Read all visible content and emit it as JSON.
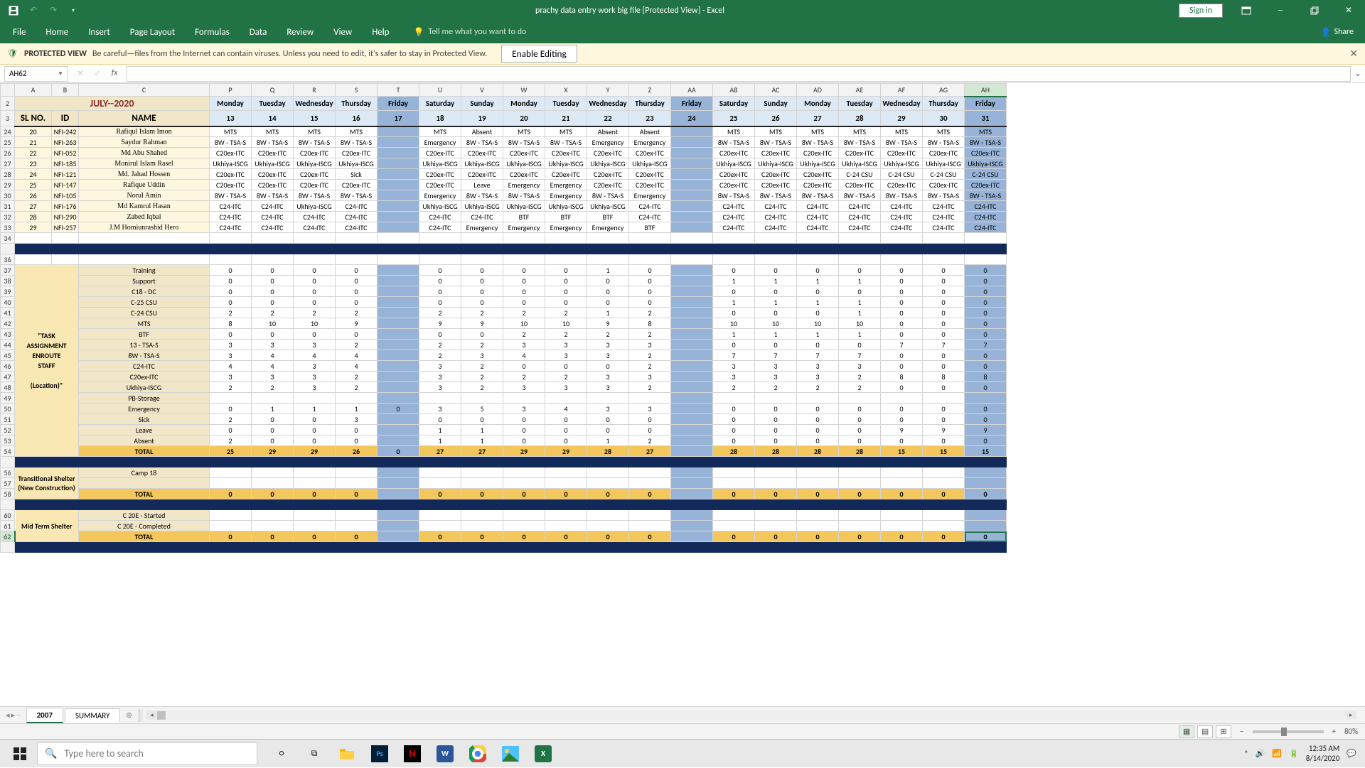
{
  "window": {
    "title": "prachy data entry work big file  [Protected View]  -  Excel",
    "signin": "Sign in"
  },
  "ribbon": {
    "tabs": [
      "File",
      "Home",
      "Insert",
      "Page Layout",
      "Formulas",
      "Data",
      "Review",
      "View",
      "Help"
    ],
    "tellme": "Tell me what you want to do",
    "share": "Share"
  },
  "protected": {
    "label": "PROTECTED VIEW",
    "text": "Be careful—files from the Internet can contain viruses. Unless you need to edit, it's safer to stay in Protected View.",
    "enable": "Enable Editing"
  },
  "namebox": "AH62",
  "cols": [
    "A",
    "B",
    "C",
    "P",
    "Q",
    "R",
    "S",
    "T",
    "U",
    "V",
    "W",
    "X",
    "Y",
    "Z",
    "AA",
    "AB",
    "AC",
    "AD",
    "AE",
    "AF",
    "AG",
    "AH"
  ],
  "month": "JULY--2020",
  "weekdays": [
    "Monday",
    "Tuesday",
    "Wednesday",
    "Thursday",
    "Friday",
    "Saturday",
    "Sunday",
    "Monday",
    "Tuesday",
    "Wednesday",
    "Thursday",
    "Friday",
    "Saturday",
    "Sunday",
    "Monday",
    "Tuesday",
    "Wednesday",
    "Thursday",
    "Friday"
  ],
  "daynums": [
    "13",
    "14",
    "15",
    "16",
    "17",
    "18",
    "19",
    "20",
    "21",
    "22",
    "23",
    "24",
    "25",
    "26",
    "27",
    "28",
    "29",
    "30",
    "31"
  ],
  "head": {
    "sl": "SL NO.",
    "id": "ID",
    "name": "NAME"
  },
  "rownums_staff": [
    "24",
    "25",
    "26",
    "27",
    "28",
    "29",
    "30",
    "31",
    "32",
    "33"
  ],
  "staff": [
    {
      "sl": "20",
      "id": "NFI-242",
      "name": "Rafiqul Islam Imon",
      "v": [
        "MTS",
        "MTS",
        "MTS",
        "MTS",
        "",
        "MTS",
        "Absent",
        "MTS",
        "MTS",
        "Absent",
        "Absent",
        "",
        "MTS",
        "MTS",
        "MTS",
        "MTS",
        "MTS",
        "MTS",
        "MTS"
      ]
    },
    {
      "sl": "21",
      "id": "NFI-263",
      "name": "Saydur Rahman",
      "v": [
        "8W - TSA-S",
        "8W - TSA-S",
        "8W - TSA-S",
        "8W - TSA-S",
        "",
        "Emergency",
        "8W - TSA-S",
        "8W - TSA-S",
        "8W - TSA-S",
        "Emergency",
        "Emergency",
        "",
        "8W - TSA-S",
        "8W - TSA-S",
        "8W - TSA-S",
        "8W - TSA-S",
        "8W - TSA-S",
        "8W - TSA-S",
        "8W - TSA-S"
      ]
    },
    {
      "sl": "22",
      "id": "NFI-052",
      "name": "Md Abu Shahed",
      "v": [
        "C20ex-ITC",
        "C20ex-ITC",
        "C20ex-ITC",
        "C20ex-ITC",
        "",
        "C20ex-ITC",
        "C20ex-ITC",
        "C20ex-ITC",
        "C20ex-ITC",
        "C20ex-ITC",
        "C20ex-ITC",
        "",
        "C20ex-ITC",
        "C20ex-ITC",
        "C20ex-ITC",
        "C20ex-ITC",
        "C20ex-ITC",
        "C20ex-ITC",
        "C20ex-ITC"
      ]
    },
    {
      "sl": "23",
      "id": "NFI-185",
      "name": "Monirul Islam Rasel",
      "v": [
        "Ukhiya-ISCG",
        "Ukhiya-ISCG",
        "Ukhiya-ISCG",
        "Ukhiya-ISCG",
        "",
        "Ukhiya-ISCG",
        "Ukhiya-ISCG",
        "Ukhiya-ISCG",
        "Ukhiya-ISCG",
        "Ukhiya-ISCG",
        "Ukhiya-ISCG",
        "",
        "Ukhiya-ISCG",
        "Ukhiya-ISCG",
        "Ukhiya-ISCG",
        "Ukhiya-ISCG",
        "Ukhiya-ISCG",
        "Ukhiya-ISCG",
        "Ukhiya-ISCG"
      ]
    },
    {
      "sl": "24",
      "id": "NFI-121",
      "name": "Md. Jahad Hossen",
      "v": [
        "C20ex-ITC",
        "C20ex-ITC",
        "C20ex-ITC",
        "Sick",
        "",
        "C20ex-ITC",
        "C20ex-ITC",
        "C20ex-ITC",
        "C20ex-ITC",
        "C20ex-ITC",
        "C20ex-ITC",
        "",
        "C20ex-ITC",
        "C20ex-ITC",
        "C20ex-ITC",
        "C-24 CSU",
        "C-24 CSU",
        "C-24 CSU",
        "C-24 CSU"
      ]
    },
    {
      "sl": "25",
      "id": "NFI-147",
      "name": "Rafique Uddin",
      "v": [
        "C20ex-ITC",
        "C20ex-ITC",
        "C20ex-ITC",
        "C20ex-ITC",
        "",
        "C20ex-ITC",
        "Leave",
        "Emergency",
        "Emergency",
        "C20ex-ITC",
        "C20ex-ITC",
        "",
        "C20ex-ITC",
        "C20ex-ITC",
        "C20ex-ITC",
        "C20ex-ITC",
        "C20ex-ITC",
        "C20ex-ITC",
        "C20ex-ITC"
      ]
    },
    {
      "sl": "26",
      "id": "NFI-105",
      "name": "Norul Amin",
      "v": [
        "8W - TSA-S",
        "8W - TSA-S",
        "8W - TSA-S",
        "8W - TSA-S",
        "",
        "Emergency",
        "8W - TSA-S",
        "8W - TSA-S",
        "Emergency",
        "8W - TSA-S",
        "Emergency",
        "",
        "8W - TSA-S",
        "8W - TSA-S",
        "8W - TSA-S",
        "8W - TSA-S",
        "8W - TSA-S",
        "8W - TSA-S",
        "8W - TSA-S"
      ]
    },
    {
      "sl": "27",
      "id": "NFI-176",
      "name": "Md Kamrul Hasan",
      "v": [
        "C24-ITC",
        "C24-ITC",
        "Ukhiya-ISCG",
        "C24-ITC",
        "",
        "Ukhiya-ISCG",
        "Ukhiya-ISCG",
        "Ukhiya-ISCG",
        "Ukhiya-ISCG",
        "Ukhiya-ISCG",
        "C24-ITC",
        "",
        "C24-ITC",
        "C24-ITC",
        "C24-ITC",
        "C24-ITC",
        "C24-ITC",
        "C24-ITC",
        "C24-ITC"
      ]
    },
    {
      "sl": "28",
      "id": "NFI-290",
      "name": "Zabed Iqbal",
      "v": [
        "C24-ITC",
        "C24-ITC",
        "C24-ITC",
        "C24-ITC",
        "",
        "C24-ITC",
        "C24-ITC",
        "BTF",
        "BTF",
        "BTF",
        "C24-ITC",
        "",
        "C24-ITC",
        "C24-ITC",
        "C24-ITC",
        "C24-ITC",
        "C24-ITC",
        "C24-ITC",
        "C24-ITC"
      ]
    },
    {
      "sl": "29",
      "id": "NFI-257",
      "name": "J.M Homiunrashid Hero",
      "v": [
        "C24-ITC",
        "C24-ITC",
        "C24-ITC",
        "C24-ITC",
        "",
        "C24-ITC",
        "Emergency",
        "Emergency",
        "Emergency",
        "Emergency",
        "BTF",
        "",
        "C24-ITC",
        "C24-ITC",
        "C24-ITC",
        "C24-ITC",
        "C24-ITC",
        "C24-ITC",
        "C24-ITC"
      ]
    }
  ],
  "task_label_lines": [
    "\"TASK",
    "ASSIGNMENT",
    "ENROUTE",
    "STAFF",
    "",
    "(Location)\""
  ],
  "rownums_task": [
    "37",
    "38",
    "39",
    "40",
    "41",
    "42",
    "43",
    "44",
    "45",
    "46",
    "47",
    "48",
    "49",
    "50",
    "51",
    "52",
    "53",
    "54"
  ],
  "tasks": [
    {
      "cat": "Training",
      "v": [
        "0",
        "0",
        "0",
        "0",
        "",
        "0",
        "0",
        "0",
        "0",
        "1",
        "0",
        "",
        "0",
        "0",
        "0",
        "0",
        "0",
        "0",
        "0"
      ]
    },
    {
      "cat": "Support",
      "v": [
        "0",
        "0",
        "0",
        "0",
        "",
        "0",
        "0",
        "0",
        "0",
        "0",
        "0",
        "",
        "1",
        "1",
        "1",
        "1",
        "0",
        "0",
        "0"
      ]
    },
    {
      "cat": "C18 - DC",
      "v": [
        "0",
        "0",
        "0",
        "0",
        "",
        "0",
        "0",
        "0",
        "0",
        "0",
        "0",
        "",
        "0",
        "0",
        "0",
        "0",
        "0",
        "0",
        "0"
      ]
    },
    {
      "cat": "C-25 CSU",
      "v": [
        "0",
        "0",
        "0",
        "0",
        "",
        "0",
        "0",
        "0",
        "0",
        "0",
        "0",
        "",
        "1",
        "1",
        "1",
        "1",
        "0",
        "0",
        "0"
      ]
    },
    {
      "cat": "C-24 CSU",
      "v": [
        "2",
        "2",
        "2",
        "2",
        "",
        "2",
        "2",
        "2",
        "2",
        "1",
        "2",
        "",
        "0",
        "0",
        "0",
        "1",
        "0",
        "0",
        "0"
      ]
    },
    {
      "cat": "MTS",
      "v": [
        "8",
        "10",
        "10",
        "9",
        "",
        "9",
        "9",
        "10",
        "10",
        "9",
        "8",
        "",
        "10",
        "10",
        "10",
        "10",
        "0",
        "0",
        "0"
      ]
    },
    {
      "cat": "BTF",
      "v": [
        "0",
        "0",
        "0",
        "0",
        "",
        "0",
        "0",
        "2",
        "2",
        "2",
        "2",
        "",
        "1",
        "1",
        "1",
        "1",
        "0",
        "0",
        "0"
      ]
    },
    {
      "cat": "13 - TSA-S",
      "v": [
        "3",
        "3",
        "3",
        "2",
        "",
        "2",
        "2",
        "3",
        "3",
        "3",
        "3",
        "",
        "0",
        "0",
        "0",
        "0",
        "7",
        "7",
        "7"
      ]
    },
    {
      "cat": "8W - TSA-S",
      "v": [
        "3",
        "4",
        "4",
        "4",
        "",
        "2",
        "3",
        "4",
        "3",
        "3",
        "2",
        "",
        "7",
        "7",
        "7",
        "7",
        "0",
        "0",
        "0"
      ]
    },
    {
      "cat": "C24-ITC",
      "v": [
        "4",
        "4",
        "3",
        "4",
        "",
        "3",
        "2",
        "0",
        "0",
        "0",
        "2",
        "",
        "3",
        "3",
        "3",
        "3",
        "0",
        "0",
        "0"
      ]
    },
    {
      "cat": "C20ex-ITC",
      "v": [
        "3",
        "3",
        "3",
        "2",
        "",
        "3",
        "2",
        "2",
        "2",
        "3",
        "3",
        "",
        "3",
        "3",
        "3",
        "2",
        "8",
        "8",
        "8"
      ]
    },
    {
      "cat": "Ukhiya-ISCG",
      "v": [
        "2",
        "2",
        "3",
        "2",
        "",
        "3",
        "2",
        "3",
        "3",
        "3",
        "2",
        "",
        "2",
        "2",
        "2",
        "2",
        "0",
        "0",
        "0"
      ]
    },
    {
      "cat": "PB-Storage",
      "v": [
        "",
        "",
        "",
        "",
        "",
        "",
        "",
        "",
        "",
        "",
        "",
        "",
        "",
        "",
        "",
        "",
        "",
        "",
        ""
      ]
    },
    {
      "cat": "Emergency",
      "v": [
        "0",
        "1",
        "1",
        "1",
        "0",
        "3",
        "5",
        "3",
        "4",
        "3",
        "3",
        "",
        "0",
        "0",
        "0",
        "0",
        "0",
        "0",
        "0"
      ]
    },
    {
      "cat": "Sick",
      "v": [
        "2",
        "0",
        "0",
        "3",
        "",
        "0",
        "0",
        "0",
        "0",
        "0",
        "0",
        "",
        "0",
        "0",
        "0",
        "0",
        "0",
        "0",
        "0"
      ]
    },
    {
      "cat": "Leave",
      "v": [
        "0",
        "0",
        "0",
        "0",
        "",
        "1",
        "1",
        "0",
        "0",
        "0",
        "0",
        "",
        "0",
        "0",
        "0",
        "0",
        "9",
        "9",
        "9"
      ]
    },
    {
      "cat": "Absent",
      "v": [
        "2",
        "0",
        "0",
        "0",
        "",
        "1",
        "1",
        "0",
        "0",
        "1",
        "2",
        "",
        "0",
        "0",
        "0",
        "0",
        "0",
        "0",
        "0"
      ]
    }
  ],
  "task_total": {
    "cat": "TOTAL",
    "v": [
      "25",
      "29",
      "29",
      "26",
      "0",
      "27",
      "27",
      "29",
      "29",
      "28",
      "27",
      "",
      "28",
      "28",
      "28",
      "28",
      "15",
      "15",
      "15"
    ]
  },
  "shelter_label_lines": [
    "Transitional Shelter",
    "(New Construction)"
  ],
  "rownums_shelter": [
    "56",
    "57",
    "58"
  ],
  "shelter": {
    "camp": "Camp 18",
    "total_lbl": "TOTAL",
    "v": [
      "0",
      "0",
      "0",
      "0",
      "",
      "0",
      "0",
      "0",
      "0",
      "0",
      "0",
      "",
      "0",
      "0",
      "0",
      "0",
      "0",
      "0",
      "0"
    ]
  },
  "mts_label": "Mid Term Shelter",
  "rownums_mts": [
    "60",
    "61",
    "62"
  ],
  "mts": {
    "rows": [
      {
        "cat": "C 20E - Started",
        "v": [
          "",
          "",
          "",
          "",
          "",
          "",
          "",
          "",
          "",
          "",
          "",
          "",
          "",
          "",
          "",
          "",
          "",
          "",
          ""
        ]
      },
      {
        "cat": "C 20E - Completed",
        "v": [
          "",
          "",
          "",
          "",
          "",
          "",
          "",
          "",
          "",
          "",
          "",
          "",
          "",
          "",
          "",
          "",
          "",
          "",
          ""
        ]
      }
    ],
    "total": {
      "cat": "TOTAL",
      "v": [
        "0",
        "0",
        "0",
        "0",
        "",
        "0",
        "0",
        "0",
        "0",
        "0",
        "0",
        "",
        "0",
        "0",
        "0",
        "0",
        "0",
        "0",
        "0"
      ]
    }
  },
  "sheet_tabs": {
    "active": "2007",
    "other": "SUMMARY"
  },
  "status": {
    "zoom": "80%"
  },
  "taskbar": {
    "search_placeholder": "Type here to search",
    "time": "12:35 AM",
    "date": "8/14/2020"
  }
}
